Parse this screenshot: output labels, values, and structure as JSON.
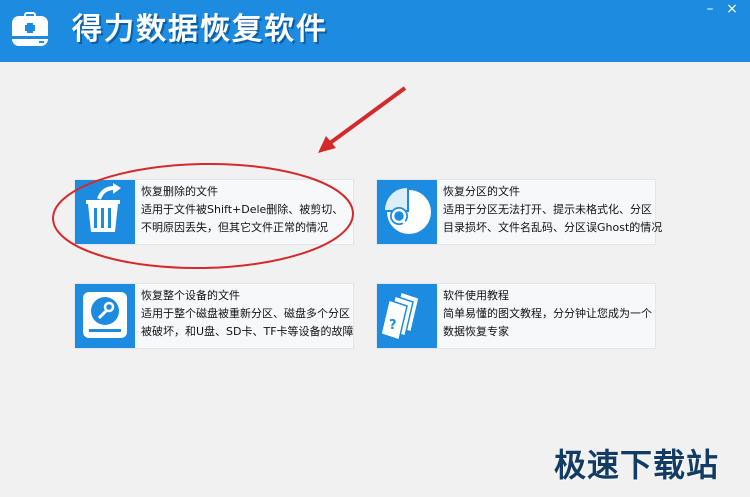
{
  "window": {
    "title": "得力数据恢复软件",
    "minimize_glyph": "–",
    "close_glyph": "×"
  },
  "cards": [
    {
      "icon": "recycle-bin-restore-icon",
      "title": "恢复删除的文件",
      "desc_line1": "适用于文件被Shift+Dele删除、被剪切、",
      "desc_line2": "不明原因丢失，但其它文件正常的情况"
    },
    {
      "icon": "partition-search-icon",
      "title": "恢复分区的文件",
      "desc_line1": "适用于分区无法打开、提示未格式化、分区",
      "desc_line2": "目录损坏、文件名乱码、分区误Ghost的情况"
    },
    {
      "icon": "hard-drive-repair-icon",
      "title": "恢复整个设备的文件",
      "desc_line1": "适用于整个磁盘被重新分区、磁盘多个分区",
      "desc_line2": "被破坏，和U盘、SD卡、TF卡等设备的故障"
    },
    {
      "icon": "tutorial-documents-icon",
      "title": "软件使用教程",
      "desc_line1": "简单易懂的图文教程，分分钟让您成为一个",
      "desc_line2": "数据恢复专家"
    }
  ],
  "watermark": {
    "text": "极速下载站"
  },
  "colors": {
    "titlebar": "#1d8be0",
    "tile": "#1d8be0",
    "annotation": "#d42a2a",
    "background": "#f1f1f1"
  }
}
